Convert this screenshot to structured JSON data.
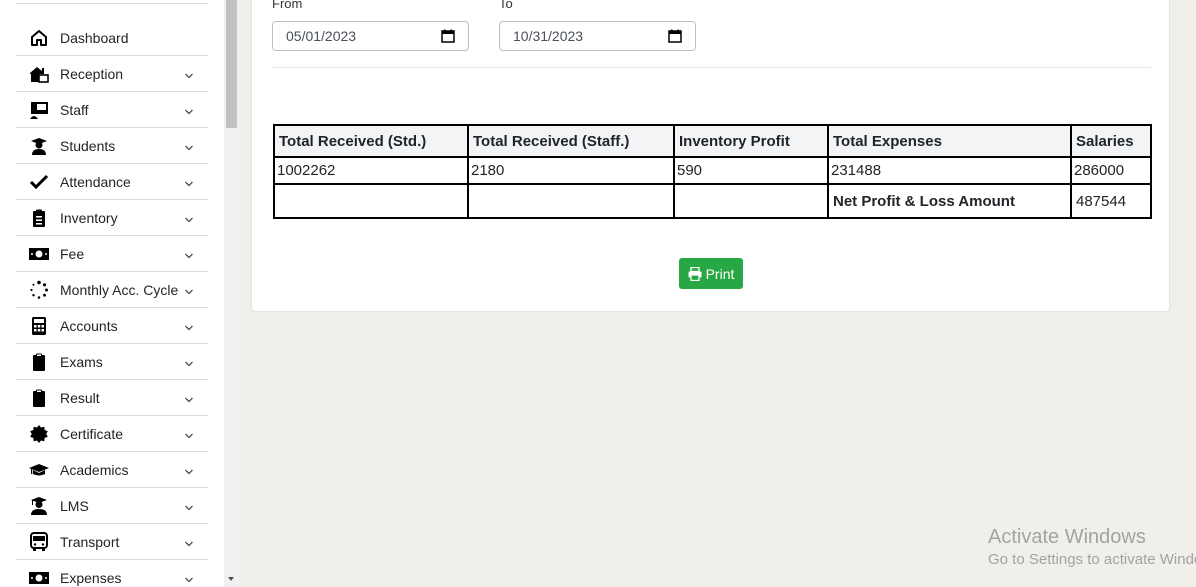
{
  "sidebar": {
    "items": [
      {
        "label": "Dashboard",
        "icon": "home-icon",
        "has_children": false
      },
      {
        "label": "Reception",
        "icon": "reception-icon",
        "has_children": true
      },
      {
        "label": "Staff",
        "icon": "staff-icon",
        "has_children": true
      },
      {
        "label": "Students",
        "icon": "student-icon",
        "has_children": true
      },
      {
        "label": "Attendance",
        "icon": "check-icon",
        "has_children": true
      },
      {
        "label": "Inventory",
        "icon": "clipboard-list-icon",
        "has_children": true
      },
      {
        "label": "Fee",
        "icon": "money-bill-icon",
        "has_children": true
      },
      {
        "label": "Monthly Acc. Cycle",
        "icon": "spinner-icon",
        "has_children": true
      },
      {
        "label": "Accounts",
        "icon": "calculator-icon",
        "has_children": true
      },
      {
        "label": "Exams",
        "icon": "clipboard-icon",
        "has_children": true
      },
      {
        "label": "Result",
        "icon": "clipboard-icon",
        "has_children": true
      },
      {
        "label": "Certificate",
        "icon": "certificate-icon",
        "has_children": true
      },
      {
        "label": "Academics",
        "icon": "graduation-cap-icon",
        "has_children": true
      },
      {
        "label": "LMS",
        "icon": "graduate-icon",
        "has_children": true
      },
      {
        "label": "Transport",
        "icon": "bus-icon",
        "has_children": true
      },
      {
        "label": "Expenses",
        "icon": "money-bill-icon",
        "has_children": true
      }
    ]
  },
  "filters": {
    "from_label": "From",
    "from_value": "05/01/2023",
    "to_label": "To",
    "to_value": "10/31/2023"
  },
  "report": {
    "headers": [
      "Total Received (Std.)",
      "Total Received (Staff.)",
      "Inventory Profit",
      "Total Expenses",
      "Salaries"
    ],
    "values": [
      "1002262",
      "2180",
      "590",
      "231488",
      "286000"
    ],
    "net_label": "Net Profit & Loss Amount",
    "net_value": "487544"
  },
  "print_label": "Print",
  "watermark": {
    "title": "Activate Windows",
    "subtitle": "Go to Settings to activate Windows."
  },
  "colors": {
    "primary_button": "#28a745",
    "page_background": "#f0efea"
  }
}
